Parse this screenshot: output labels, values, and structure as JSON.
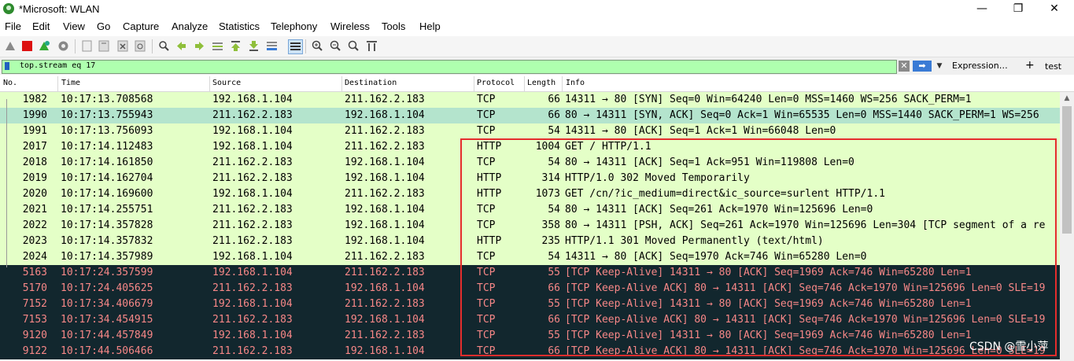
{
  "window": {
    "title": "*Microsoft: WLAN",
    "controls": [
      "—",
      "❐",
      "✕"
    ]
  },
  "menu": [
    "File",
    "Edit",
    "View",
    "Go",
    "Capture",
    "Analyze",
    "Statistics",
    "Telephony",
    "Wireless",
    "Tools",
    "Help"
  ],
  "filter": {
    "value": "top.stream eq 17",
    "expression_label": "Expression…",
    "plus_label": "+",
    "test_label": "test"
  },
  "columns": [
    "No.",
    "Time",
    "Source",
    "Destination",
    "Protocol",
    "Length",
    "Info"
  ],
  "packets": [
    {
      "no": "1982",
      "time": "10:17:13.708568",
      "src": "192.168.1.104",
      "dst": "211.162.2.183",
      "proto": "TCP",
      "len": "66",
      "info": "14311 → 80 [SYN] Seq=0 Win=64240 Len=0 MSS=1460 WS=256 SACK_PERM=1",
      "style": "light"
    },
    {
      "no": "1990",
      "time": "10:17:13.755943",
      "src": "211.162.2.183",
      "dst": "192.168.1.104",
      "proto": "TCP",
      "len": "66",
      "info": "80 → 14311 [SYN, ACK] Seq=0 Ack=1 Win=65535 Len=0 MSS=1440 SACK_PERM=1 WS=256",
      "style": "selected"
    },
    {
      "no": "1991",
      "time": "10:17:13.756093",
      "src": "192.168.1.104",
      "dst": "211.162.2.183",
      "proto": "TCP",
      "len": "54",
      "info": "14311 → 80 [ACK] Seq=1 Ack=1 Win=66048 Len=0",
      "style": "light"
    },
    {
      "no": "2017",
      "time": "10:17:14.112483",
      "src": "192.168.1.104",
      "dst": "211.162.2.183",
      "proto": "HTTP",
      "len": "1004",
      "info": "GET / HTTP/1.1",
      "style": "light"
    },
    {
      "no": "2018",
      "time": "10:17:14.161850",
      "src": "211.162.2.183",
      "dst": "192.168.1.104",
      "proto": "TCP",
      "len": "54",
      "info": "80 → 14311 [ACK] Seq=1 Ack=951 Win=119808 Len=0",
      "style": "light"
    },
    {
      "no": "2019",
      "time": "10:17:14.162704",
      "src": "211.162.2.183",
      "dst": "192.168.1.104",
      "proto": "HTTP",
      "len": "314",
      "info": "HTTP/1.0 302 Moved Temporarily",
      "style": "light"
    },
    {
      "no": "2020",
      "time": "10:17:14.169600",
      "src": "192.168.1.104",
      "dst": "211.162.2.183",
      "proto": "HTTP",
      "len": "1073",
      "info": "GET /cn/?ic_medium=direct&ic_source=surlent HTTP/1.1",
      "style": "light"
    },
    {
      "no": "2021",
      "time": "10:17:14.255751",
      "src": "211.162.2.183",
      "dst": "192.168.1.104",
      "proto": "TCP",
      "len": "54",
      "info": "80 → 14311 [ACK] Seq=261 Ack=1970 Win=125696 Len=0",
      "style": "light"
    },
    {
      "no": "2022",
      "time": "10:17:14.357828",
      "src": "211.162.2.183",
      "dst": "192.168.1.104",
      "proto": "TCP",
      "len": "358",
      "info": "80 → 14311 [PSH, ACK] Seq=261 Ack=1970 Win=125696 Len=304 [TCP segment of a re",
      "style": "light"
    },
    {
      "no": "2023",
      "time": "10:17:14.357832",
      "src": "211.162.2.183",
      "dst": "192.168.1.104",
      "proto": "HTTP",
      "len": "235",
      "info": "HTTP/1.1 301 Moved Permanently  (text/html)",
      "style": "light"
    },
    {
      "no": "2024",
      "time": "10:17:14.357989",
      "src": "192.168.1.104",
      "dst": "211.162.2.183",
      "proto": "TCP",
      "len": "54",
      "info": "14311 → 80 [ACK] Seq=1970 Ack=746 Win=65280 Len=0",
      "style": "light"
    },
    {
      "no": "5163",
      "time": "10:17:24.357599",
      "src": "192.168.1.104",
      "dst": "211.162.2.183",
      "proto": "TCP",
      "len": "55",
      "info": "[TCP Keep-Alive] 14311 → 80 [ACK] Seq=1969 Ack=746 Win=65280 Len=1",
      "style": "dark"
    },
    {
      "no": "5170",
      "time": "10:17:24.405625",
      "src": "211.162.2.183",
      "dst": "192.168.1.104",
      "proto": "TCP",
      "len": "66",
      "info": "[TCP Keep-Alive ACK] 80 → 14311 [ACK] Seq=746 Ack=1970 Win=125696 Len=0 SLE=19",
      "style": "dark"
    },
    {
      "no": "7152",
      "time": "10:17:34.406679",
      "src": "192.168.1.104",
      "dst": "211.162.2.183",
      "proto": "TCP",
      "len": "55",
      "info": "[TCP Keep-Alive] 14311 → 80 [ACK] Seq=1969 Ack=746 Win=65280 Len=1",
      "style": "dark"
    },
    {
      "no": "7153",
      "time": "10:17:34.454915",
      "src": "211.162.2.183",
      "dst": "192.168.1.104",
      "proto": "TCP",
      "len": "66",
      "info": "[TCP Keep-Alive ACK] 80 → 14311 [ACK] Seq=746 Ack=1970 Win=125696 Len=0 SLE=19",
      "style": "dark"
    },
    {
      "no": "9120",
      "time": "10:17:44.457849",
      "src": "192.168.1.104",
      "dst": "211.162.2.183",
      "proto": "TCP",
      "len": "55",
      "info": "[TCP Keep-Alive] 14311 → 80 [ACK] Seq=1969 Ack=746 Win=65280 Len=1",
      "style": "dark"
    },
    {
      "no": "9122",
      "time": "10:17:44.506466",
      "src": "211.162.2.183",
      "dst": "192.168.1.104",
      "proto": "TCP",
      "len": "66",
      "info": "[TCP Keep-Alive ACK] 80 → 14311 [ACK] Seq=746 Ack=1970 Win=125696 Len=0 SLE=19",
      "style": "dark"
    }
  ],
  "watermark": "CSDN @雪小萍",
  "colors": {
    "light_row": "#e4ffc7",
    "selected_row": "#b4e4cd",
    "dark_row": "#12272e",
    "dark_text": "#f78787",
    "filter_bg": "#afffaf",
    "highlight_box": "#e52d2d"
  }
}
